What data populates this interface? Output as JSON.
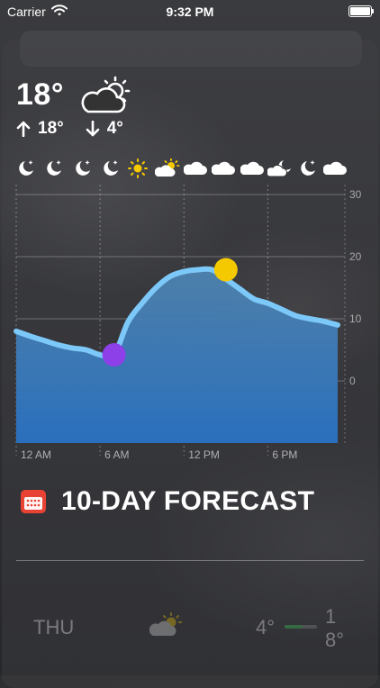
{
  "status_bar": {
    "carrier": "Carrier",
    "time": "9:32 PM"
  },
  "current": {
    "temperature": "18°",
    "condition_icon": "cloud-sun-icon",
    "high": "18°",
    "low": "4°"
  },
  "hourly_icons": [
    "moon-stars-icon",
    "moon-stars-icon",
    "moon-stars-icon",
    "moon-stars-icon",
    "sun-icon",
    "cloud-sun-icon",
    "cloud-icon",
    "cloud-icon",
    "cloud-icon",
    "cloud-moon-icon",
    "moon-stars-icon",
    "cloud-icon"
  ],
  "chart_data": {
    "type": "area",
    "x": [
      0,
      1,
      2,
      3,
      4,
      5,
      6,
      7,
      8,
      9,
      10,
      11,
      12,
      13,
      14,
      15,
      16,
      17,
      18,
      19,
      20,
      21,
      22,
      23
    ],
    "x_tick_labels": [
      "12 AM",
      "6 AM",
      "12 PM",
      "6 PM"
    ],
    "x_tick_positions": [
      0,
      6,
      12,
      18
    ],
    "y_tick_labels": [
      "30",
      "20",
      "10",
      "0"
    ],
    "ylim": [
      -10,
      30
    ],
    "grid": true,
    "series": [
      {
        "values": [
          8,
          7.2,
          6.5,
          5.8,
          5.3,
          5,
          4.2,
          4.2,
          9.5,
          12.5,
          15,
          16.8,
          17.6,
          17.9,
          17.9,
          16.4,
          14.8,
          13.2,
          12.5,
          11.5,
          10.5,
          10,
          9.6,
          9
        ]
      }
    ],
    "low_marker": {
      "x": 7,
      "value": 4.2,
      "color": "#8d3fe8"
    },
    "high_marker": {
      "x": 15,
      "value": 17.9,
      "color": "#f5c900"
    },
    "colors": {
      "line": "#7cc8f8",
      "area_top": "#4f87b5",
      "area_bottom": "#2a6fbd"
    }
  },
  "forecast": {
    "title": "10-DAY FORECAST",
    "days": [
      {
        "day": "THU",
        "icon": "cloud-sun-icon",
        "low": "4°",
        "high": "18°",
        "range_fill": 0.55
      }
    ]
  }
}
